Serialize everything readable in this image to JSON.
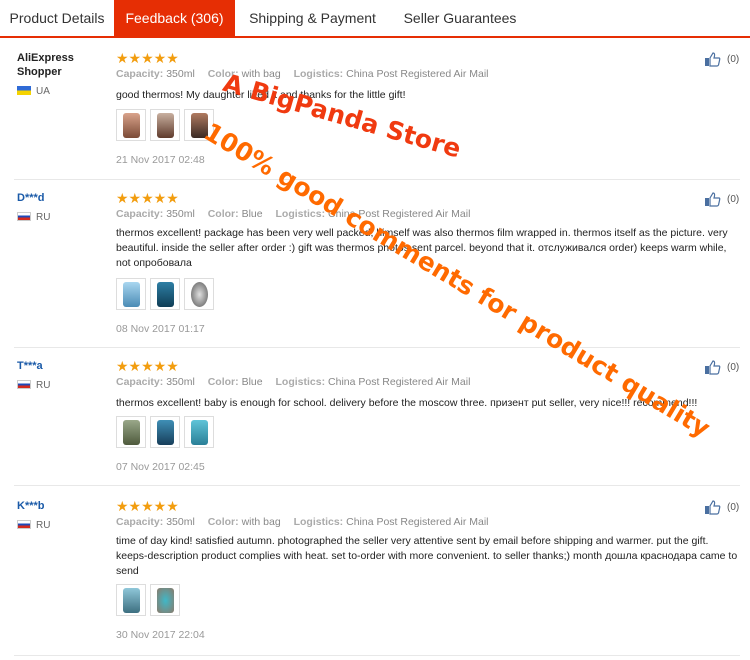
{
  "tabs": [
    {
      "label": "Product Details"
    },
    {
      "label": "Feedback (306)"
    },
    {
      "label": "Shipping & Payment"
    },
    {
      "label": "Seller Guarantees"
    }
  ],
  "labels": {
    "capacity": "Capacity:",
    "color": "Color:",
    "logistics": "Logistics:"
  },
  "reviews": [
    {
      "user": "AliExpress Shopper",
      "country": "UA",
      "stars": "★★★★★",
      "capacity": "350ml",
      "color": "with bag",
      "logistics": "China Post Registered Air Mail",
      "text": "good thermos! My daughter liked it and thanks for the little gift!",
      "date": "21 Nov 2017 02:48",
      "likes": "(0)"
    },
    {
      "user": "D***d",
      "country": "RU",
      "stars": "★★★★★",
      "capacity": "350ml",
      "color": "Blue",
      "logistics": "China Post Registered Air Mail",
      "text": "thermos excellent! package has been very well packed, himself was also thermos film wrapped in. thermos itself as the picture. very beautiful. inside the seller after order :) gift was thermos photos sent parcel. beyond that it. отслуживался order) keeps warm while, not опробовала",
      "date": "08 Nov 2017 01:17",
      "likes": "(0)"
    },
    {
      "user": "T***a",
      "country": "RU",
      "stars": "★★★★★",
      "capacity": "350ml",
      "color": "Blue",
      "logistics": "China Post Registered Air Mail",
      "text": "thermos excellent! baby is enough for school. delivery before the moscow three. призент put seller, very nice!!! recommend!!!",
      "date": "07 Nov 2017 02:45",
      "likes": "(0)"
    },
    {
      "user": "K***b",
      "country": "RU",
      "stars": "★★★★★",
      "capacity": "350ml",
      "color": "with bag",
      "logistics": "China Post Registered Air Mail",
      "text": "time of day kind! satisfied autumn. photographed the seller very attentive sent by email before shipping and warmer. put the gift. keeps-description product complies with heat. set to-order with more convenient. to seller thanks;) month дошла краснодара came to send",
      "date": "30 Nov 2017 22:04",
      "likes": "(0)"
    }
  ],
  "watermark": {
    "line1": "A BigPanda Store",
    "line2": "100% good comments for product quality"
  },
  "colors": {
    "accent": "#e62e04",
    "star": "#f29d0f",
    "watermark": "#ff6a00"
  },
  "icons": {
    "like": "thumbs-up-icon",
    "star": "star-icon"
  }
}
